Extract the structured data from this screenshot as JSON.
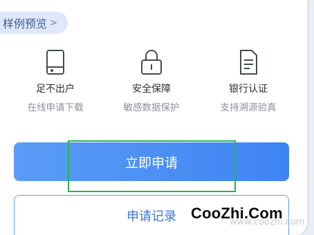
{
  "preview": {
    "label": "样例预览",
    "chevron": ">"
  },
  "features": [
    {
      "icon": "tablet-icon",
      "title": "足不出户",
      "subtitle": "在线申请下载"
    },
    {
      "icon": "lock-icon",
      "title": "安全保障",
      "subtitle": "敏感数据保护"
    },
    {
      "icon": "document-icon",
      "title": "银行认证",
      "subtitle": "支持溯源验真"
    }
  ],
  "buttons": {
    "apply": "立即申请",
    "records": "申请记录"
  },
  "watermark": {
    "text": "CooZhi.Com",
    "faint_text": "www.coozhi.com"
  },
  "colors": {
    "primary": "#4a8ef5",
    "highlight": "#28b44a",
    "pill_bg": "#dfe8fb"
  }
}
